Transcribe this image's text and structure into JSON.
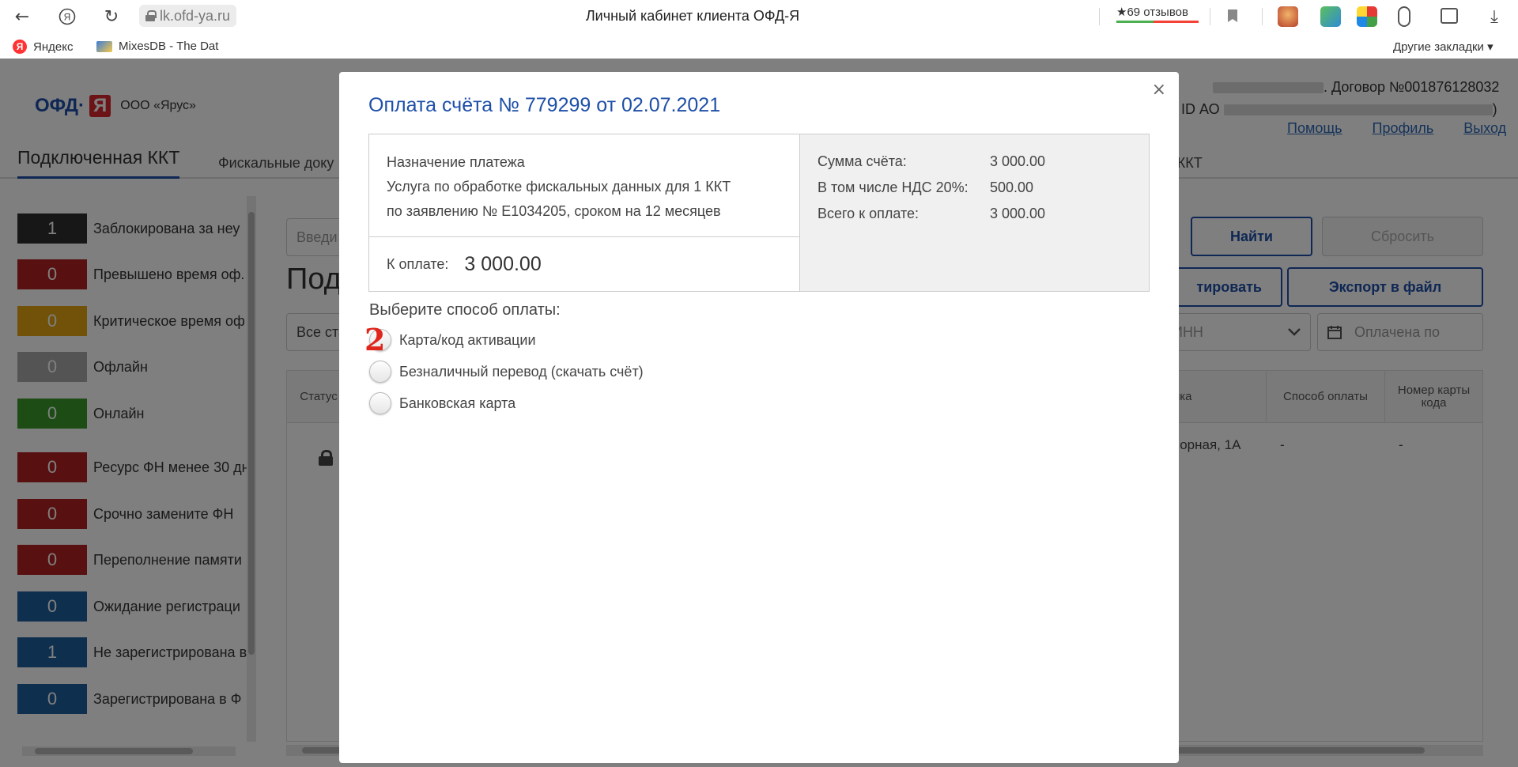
{
  "browser": {
    "url": "lk.ofd-ya.ru",
    "tab_title": "Личный кабинет клиента ОФД-Я",
    "reviews": "★69 отзывов",
    "bookmarks": [
      "Яндекс",
      "MixesDB - The Dat"
    ],
    "other_bookmarks": "Другие закладки ▾",
    "icons": {
      "back": "arrow-left-icon",
      "yandex": "yandex-icon",
      "reload": "reload-icon",
      "bookmark": "bookmark-icon",
      "download": "download-icon"
    },
    "colors": {
      "reviews_good": "#4caf50",
      "reviews_bad": "#f44336"
    }
  },
  "header": {
    "logo_text": "ОФД·",
    "logo_ya": "Я",
    "org_name": "ООО «Ярус»",
    "contract": ". Договор №001876128032",
    "id_label": "ID АО",
    "id_end": ")",
    "links": [
      "Помощь",
      "Профиль",
      "Выход"
    ]
  },
  "tabs": {
    "active": "Подключенная ККТ",
    "docs": "Фискальные доку",
    "kkt": "я ККТ"
  },
  "statuses": [
    {
      "count": "1",
      "label": "Заблокирована за неу",
      "color": "#2f2f2f"
    },
    {
      "count": "0",
      "label": "Превышено время оф.",
      "color": "#b02020"
    },
    {
      "count": "0",
      "label": "Критическое время оф",
      "color": "#e2a410"
    },
    {
      "count": "0",
      "label": "Офлайн",
      "color": "#a8a8a8"
    },
    {
      "count": "0",
      "label": "Онлайн",
      "color": "#3a9a2b"
    },
    {
      "count": "0",
      "label": "Ресурс ФН менее 30 дн",
      "color": "#b02020"
    },
    {
      "count": "0",
      "label": "Срочно замените ФН",
      "color": "#b02020"
    },
    {
      "count": "0",
      "label": "Переполнение памяти",
      "color": "#b02020"
    },
    {
      "count": "0",
      "label": "Ожидание регистраци",
      "color": "#1f5f9e"
    },
    {
      "count": "1",
      "label": "Не зарегистрирована в",
      "color": "#1f5f9e"
    },
    {
      "count": "0",
      "label": "Зарегистрирована в Ф",
      "color": "#1f5f9e"
    }
  ],
  "filters": {
    "search_placeholder": "Введи",
    "page_heading": "Под",
    "status_select": "Все ста",
    "find": "Найти",
    "reset": "Сбросить",
    "edit": "тировать",
    "export": "Экспорт в файл",
    "inn": "ИНН",
    "paid_until": "Оплачена по"
  },
  "table": {
    "col_status": "Статус",
    "col_point": "чка",
    "col_method": "Способ оплаты",
    "col_code": "Номер карты кода",
    "row_address": "порная, 1А",
    "row_method": "-",
    "row_code": "-"
  },
  "modal": {
    "title": "Оплата счёта № 779299 от 02.07.2021",
    "close": "×",
    "purpose_label": "Назначение платежа",
    "purpose_line1": "Услуга по обработке фискальных данных для 1 ККТ",
    "purpose_line2": "по заявлению № Е1034205, сроком на 12 месяцев",
    "to_pay_label": "К оплате:",
    "to_pay_value": "3 000.00",
    "sums": [
      {
        "label": "Сумма счёта:",
        "value": "3 000.00"
      },
      {
        "label": "В том числе НДС 20%:",
        "value": "500.00"
      },
      {
        "label": "Всего к оплате:",
        "value": "3 000.00"
      }
    ],
    "method_label": "Выберите способ оплаты:",
    "methods": [
      "Карта/код активации",
      "Безналичный перевод (скачать счёт)",
      "Банковская карта"
    ],
    "step_marker": "2",
    "accent": "#1e4fa8"
  }
}
